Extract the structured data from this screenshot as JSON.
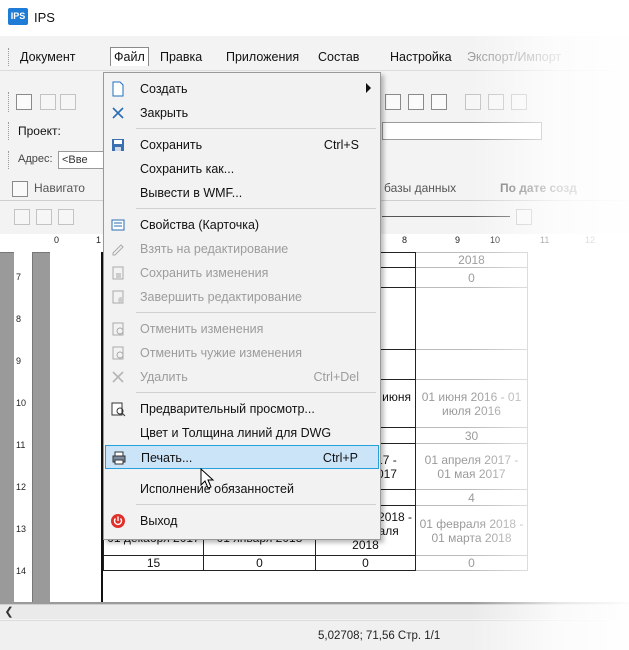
{
  "window": {
    "title": "IPS",
    "logo_text": "IPS"
  },
  "menubar": {
    "items": [
      {
        "label": "Документ"
      },
      {
        "label": "Файл"
      },
      {
        "label": "Правка"
      },
      {
        "label": "Приложения"
      },
      {
        "label": "Состав"
      },
      {
        "label": "Настройка"
      },
      {
        "label": "Экспорт/Импорт"
      }
    ]
  },
  "toolbar": {
    "project_label": "Проект:",
    "address_label": "Адрес:",
    "address_value": "<Вве"
  },
  "tabs": [
    {
      "label": "Навигато"
    },
    {
      "label": "базы данных"
    },
    {
      "label": "По дате созд"
    }
  ],
  "file_menu": {
    "items": [
      {
        "label": "Создать",
        "shortcut": "",
        "icon": "new-document-icon",
        "enabled": true,
        "submenu": true
      },
      {
        "label": "Закрыть",
        "shortcut": "",
        "icon": "close-icon",
        "enabled": true
      },
      {
        "label": "Сохранить",
        "shortcut": "Ctrl+S",
        "icon": "save-icon",
        "enabled": true
      },
      {
        "label": "Сохранить как...",
        "shortcut": "",
        "icon": "",
        "enabled": true
      },
      {
        "label": "Вывести в WMF...",
        "shortcut": "",
        "icon": "",
        "enabled": true
      },
      {
        "label": "Свойства (Карточка)",
        "shortcut": "",
        "icon": "properties-card-icon",
        "enabled": true
      },
      {
        "label": "Взять на редактирование",
        "shortcut": "",
        "icon": "edit-take-icon",
        "enabled": false
      },
      {
        "label": "Сохранить изменения",
        "shortcut": "",
        "icon": "save-changes-icon",
        "enabled": false
      },
      {
        "label": "Завершить редактирование",
        "shortcut": "",
        "icon": "finish-edit-icon",
        "enabled": false
      },
      {
        "label": "Отменить изменения",
        "shortcut": "",
        "icon": "undo-changes-icon",
        "enabled": false
      },
      {
        "label": "Отменить чужие изменения",
        "shortcut": "",
        "icon": "undo-others-icon",
        "enabled": false
      },
      {
        "label": "Удалить",
        "shortcut": "Ctrl+Del",
        "icon": "delete-icon",
        "enabled": false
      },
      {
        "label": "Предварительный просмотр...",
        "shortcut": "",
        "icon": "print-preview-icon",
        "enabled": true
      },
      {
        "label": "Цвет и Толщина линий для DWG",
        "shortcut": "",
        "icon": "",
        "enabled": true
      },
      {
        "label": "Печать...",
        "shortcut": "Ctrl+P",
        "icon": "printer-icon",
        "enabled": true,
        "highlighted": true
      },
      {
        "label": "Исполнение обязанностей",
        "shortcut": "",
        "icon": "",
        "enabled": true
      },
      {
        "label": "Выход",
        "shortcut": "",
        "icon": "power-icon",
        "enabled": true
      }
    ]
  },
  "ruler": {
    "h_numbers": [
      "0",
      "1",
      "8",
      "9",
      "10",
      "11",
      "12"
    ],
    "v_numbers": [
      "7",
      "8",
      "9",
      "10",
      "11",
      "12",
      "13",
      "14"
    ]
  },
  "document_table": {
    "rows": [
      [
        "",
        "",
        "2018",
        "2018"
      ],
      [
        "",
        "",
        "0",
        "0"
      ],
      [
        "",
        "",
        "",
        ""
      ],
      [
        "",
        "",
        "",
        ""
      ],
      [
        "",
        "",
        "мая 2016 - июня 2016",
        "01 июня 2016 - 01 июля 2016"
      ],
      [
        "",
        "",
        "0",
        "30"
      ],
      [
        "",
        "",
        "арта 2017 - преля 2017",
        "01 апреля 2017 - 01 мая 2017"
      ],
      [
        "",
        "",
        "0",
        "4"
      ],
      [
        "01 ноября 2017 - 01 декабря 2017",
        "01 декабря 2017 - 01 января 2018",
        "01 января 2018 - 01 февраля 2018",
        "01 февраля 2018 - 01 марта 2018"
      ],
      [
        "15",
        "0",
        "0",
        "0"
      ]
    ]
  },
  "status": {
    "coords": "5,02708; 71,56 Стр. 1/1"
  }
}
